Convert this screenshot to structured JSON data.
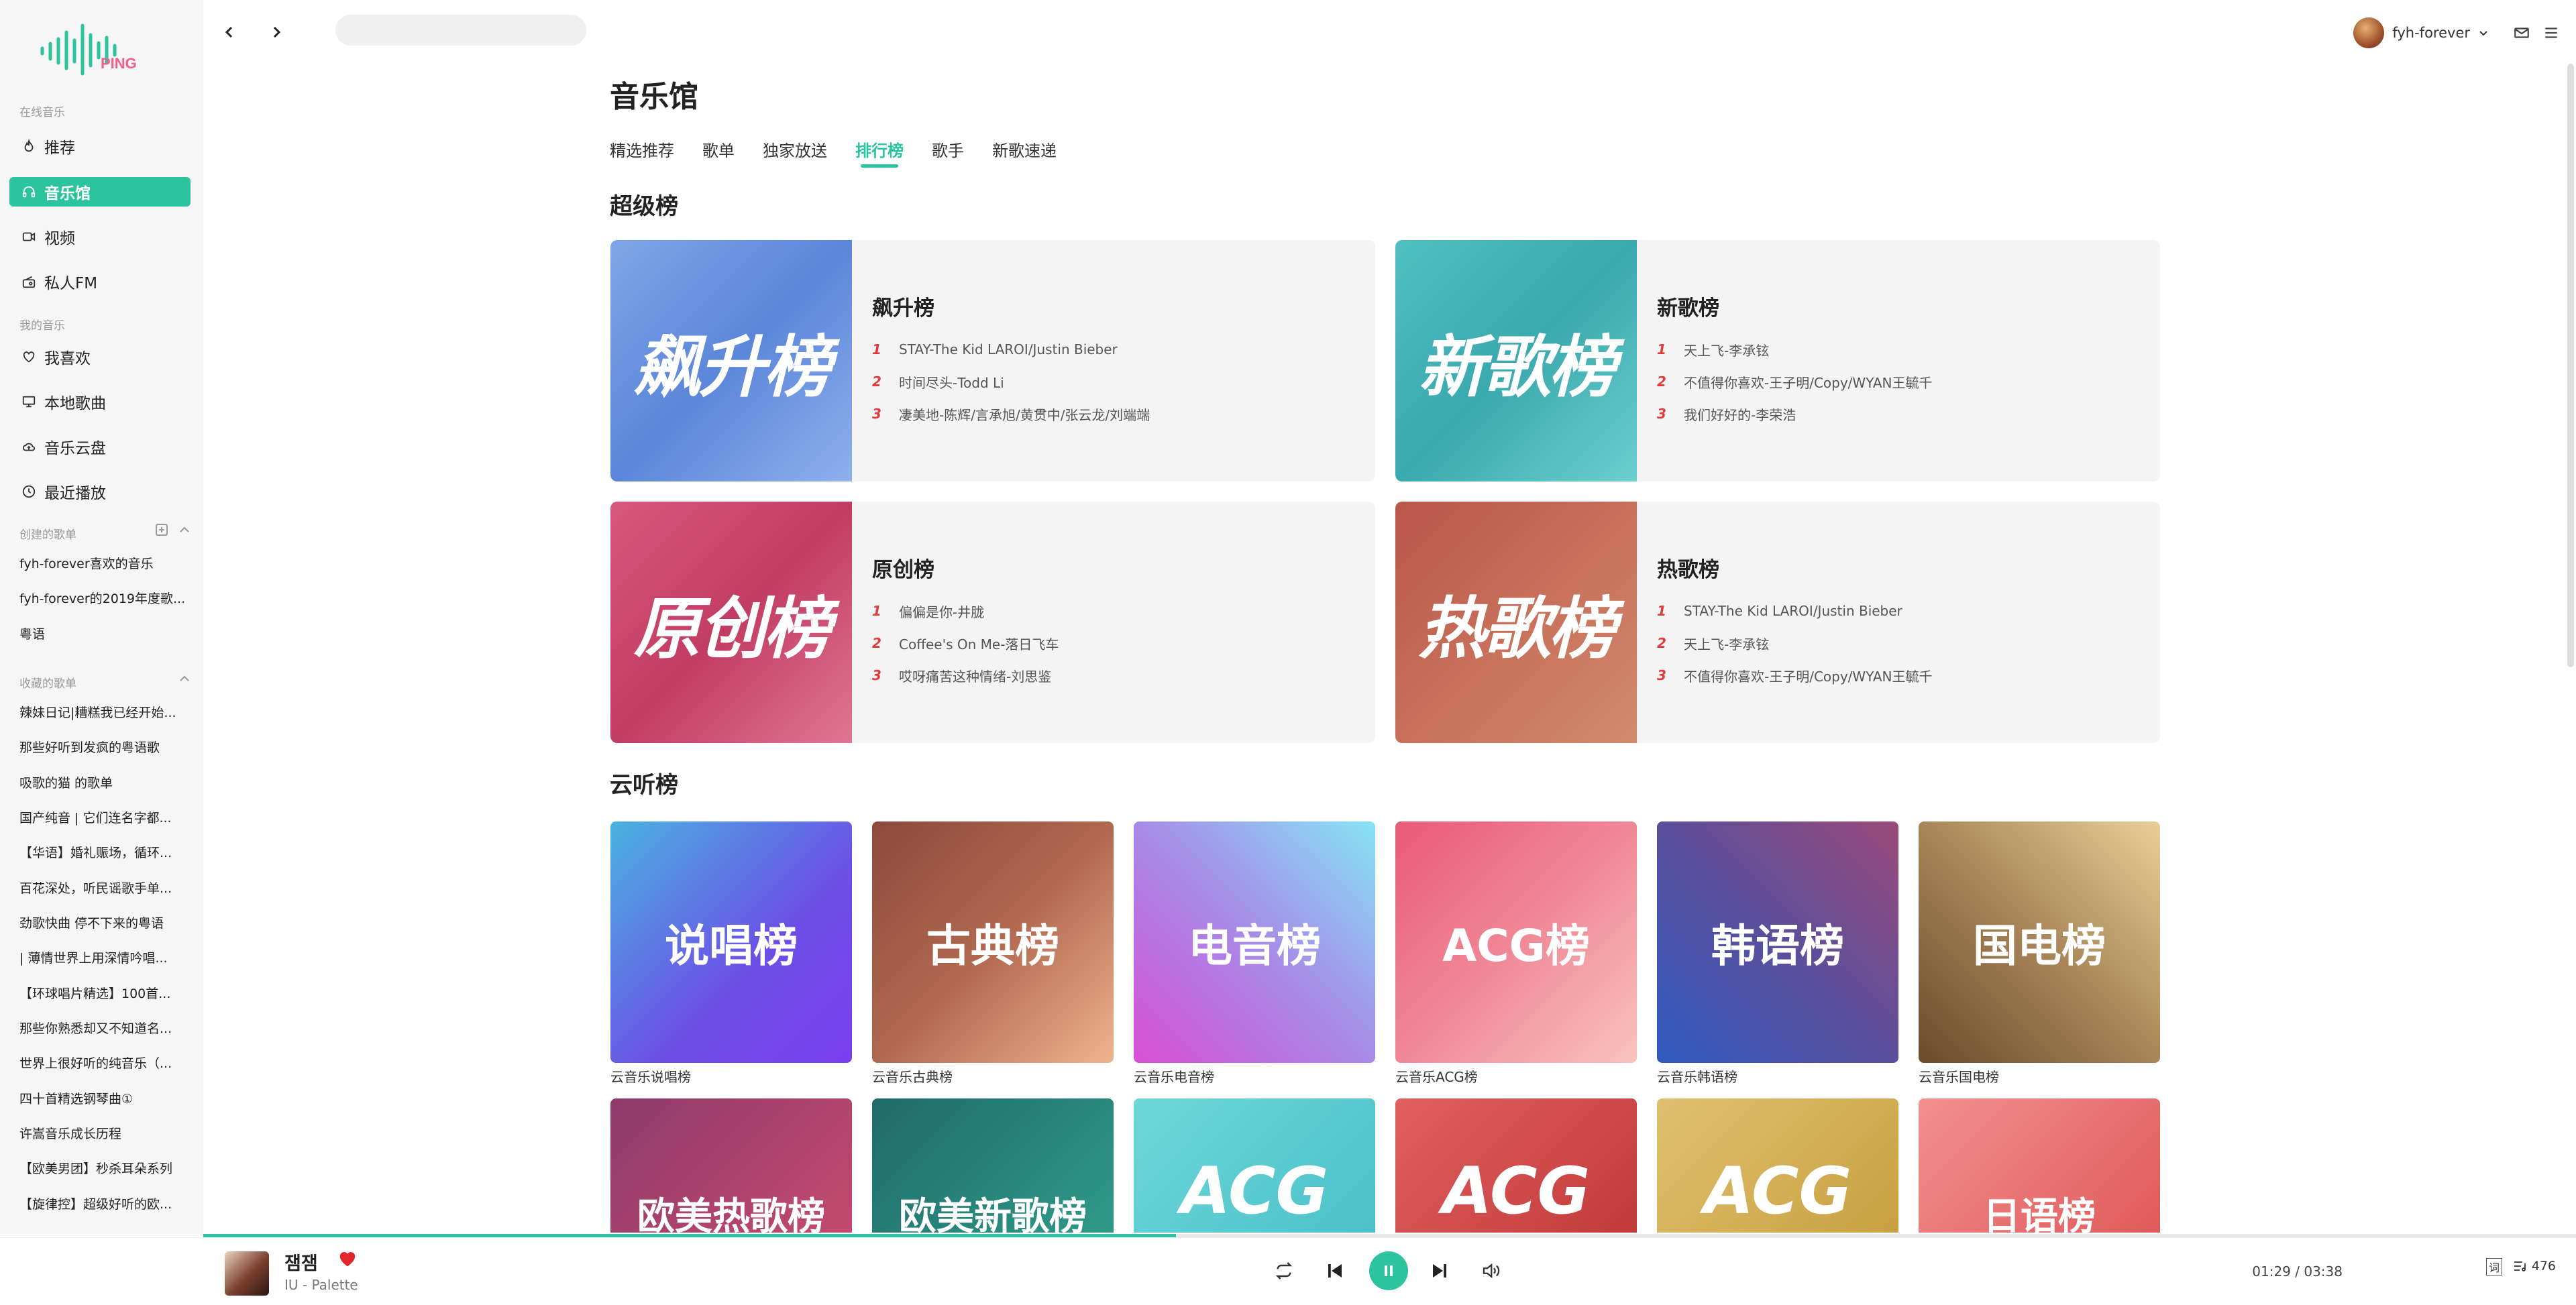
{
  "brand": {
    "logo_text": "PING",
    "accent": "#2bc49f"
  },
  "search": {
    "placeholder": ""
  },
  "user": {
    "name": "fyh-forever"
  },
  "sidebar": {
    "section_online": "在线音乐",
    "online_items": [
      {
        "label": "推荐",
        "icon": "flame-icon"
      },
      {
        "label": "音乐馆",
        "icon": "headphones-icon"
      },
      {
        "label": "视频",
        "icon": "video-icon"
      },
      {
        "label": "私人FM",
        "icon": "radio-icon"
      }
    ],
    "section_my": "我的音乐",
    "my_items": [
      {
        "label": "我喜欢",
        "icon": "heart-icon"
      },
      {
        "label": "本地歌曲",
        "icon": "monitor-icon"
      },
      {
        "label": "音乐云盘",
        "icon": "cloud-icon"
      },
      {
        "label": "最近播放",
        "icon": "clock-icon"
      }
    ],
    "section_created": "创建的歌单",
    "created": [
      "fyh-forever喜欢的音乐",
      "fyh-forever的2019年度歌...",
      "粤语"
    ],
    "section_collected": "收藏的歌单",
    "collected": [
      "辣妹日记|糟糕我已经开始...",
      "那些好听到发疯的粤语歌",
      "吸歌的猫 的歌单",
      "国产纯音 | 它们连名字都...",
      "【华语】婚礼赈场，循环...",
      "百花深处，听民谣歌手单...",
      "劲歌快曲 停不下来的粤语",
      "| 薄情世界上用深情吟唱...",
      "【环球唱片精选】100首...",
      "那些你熟悉却又不知道名...",
      "世界上很好听的纯音乐（...",
      "四十首精选钢琴曲①",
      "许嵩音乐成长历程",
      "【欧美男团】秒杀耳朵系列",
      "【旋律控】超级好听的欧..."
    ]
  },
  "main": {
    "title": "音乐馆",
    "tabs": [
      "精选推荐",
      "歌单",
      "独家放送",
      "排行榜",
      "歌手",
      "新歌速递"
    ],
    "active_tab": "排行榜",
    "section_super": "超级榜",
    "super_charts": [
      {
        "name": "飙升榜",
        "cover_text": "飙升榜",
        "tracks": [
          "STAY-The Kid LAROI/Justin Bieber",
          "时间尽头-Todd Li",
          "凄美地-陈辉/言承旭/黄贯中/张云龙/刘端端"
        ]
      },
      {
        "name": "新歌榜",
        "cover_text": "新歌榜",
        "tracks": [
          "天上飞-李承铉",
          "不值得你喜欢-王子明/Copy/WYAN王毓千",
          "我们好好的-李荣浩"
        ]
      },
      {
        "name": "原创榜",
        "cover_text": "原创榜",
        "tracks": [
          "偏偏是你-井胧",
          "Coffee's On Me-落日飞车",
          "哎呀痛苦这种情绪-刘思鉴"
        ]
      },
      {
        "name": "热歌榜",
        "cover_text": "热歌榜",
        "tracks": [
          "STAY-The Kid LAROI/Justin Bieber",
          "天上飞-李承铉",
          "不值得你喜欢-王子明/Copy/WYAN王毓千"
        ]
      }
    ],
    "track_numbers": [
      "1",
      "2",
      "3"
    ],
    "section_cloud": "云听榜",
    "cloud_charts": [
      {
        "cover_text": "说唱榜",
        "name": "云音乐说唱榜"
      },
      {
        "cover_text": "古典榜",
        "name": "云音乐古典榜"
      },
      {
        "cover_text": "电音榜",
        "name": "云音乐电音榜"
      },
      {
        "cover_text": "ACG榜",
        "name": "云音乐ACG榜"
      },
      {
        "cover_text": "韩语榜",
        "name": "云音乐韩语榜"
      },
      {
        "cover_text": "国电榜",
        "name": "云音乐国电榜"
      }
    ],
    "more_charts": [
      {
        "cover_text": "欧美热歌榜"
      },
      {
        "cover_text": "欧美新歌榜"
      },
      {
        "cover_text": "ACG"
      },
      {
        "cover_text": "ACG"
      },
      {
        "cover_text": "ACG"
      },
      {
        "cover_text": "日语榜"
      }
    ]
  },
  "player": {
    "title": "잼잼",
    "artist": "IU - Palette",
    "time": "01:29 / 03:38",
    "progress": 0.41,
    "quality": "词",
    "playlist_count": "476",
    "liked": true
  }
}
